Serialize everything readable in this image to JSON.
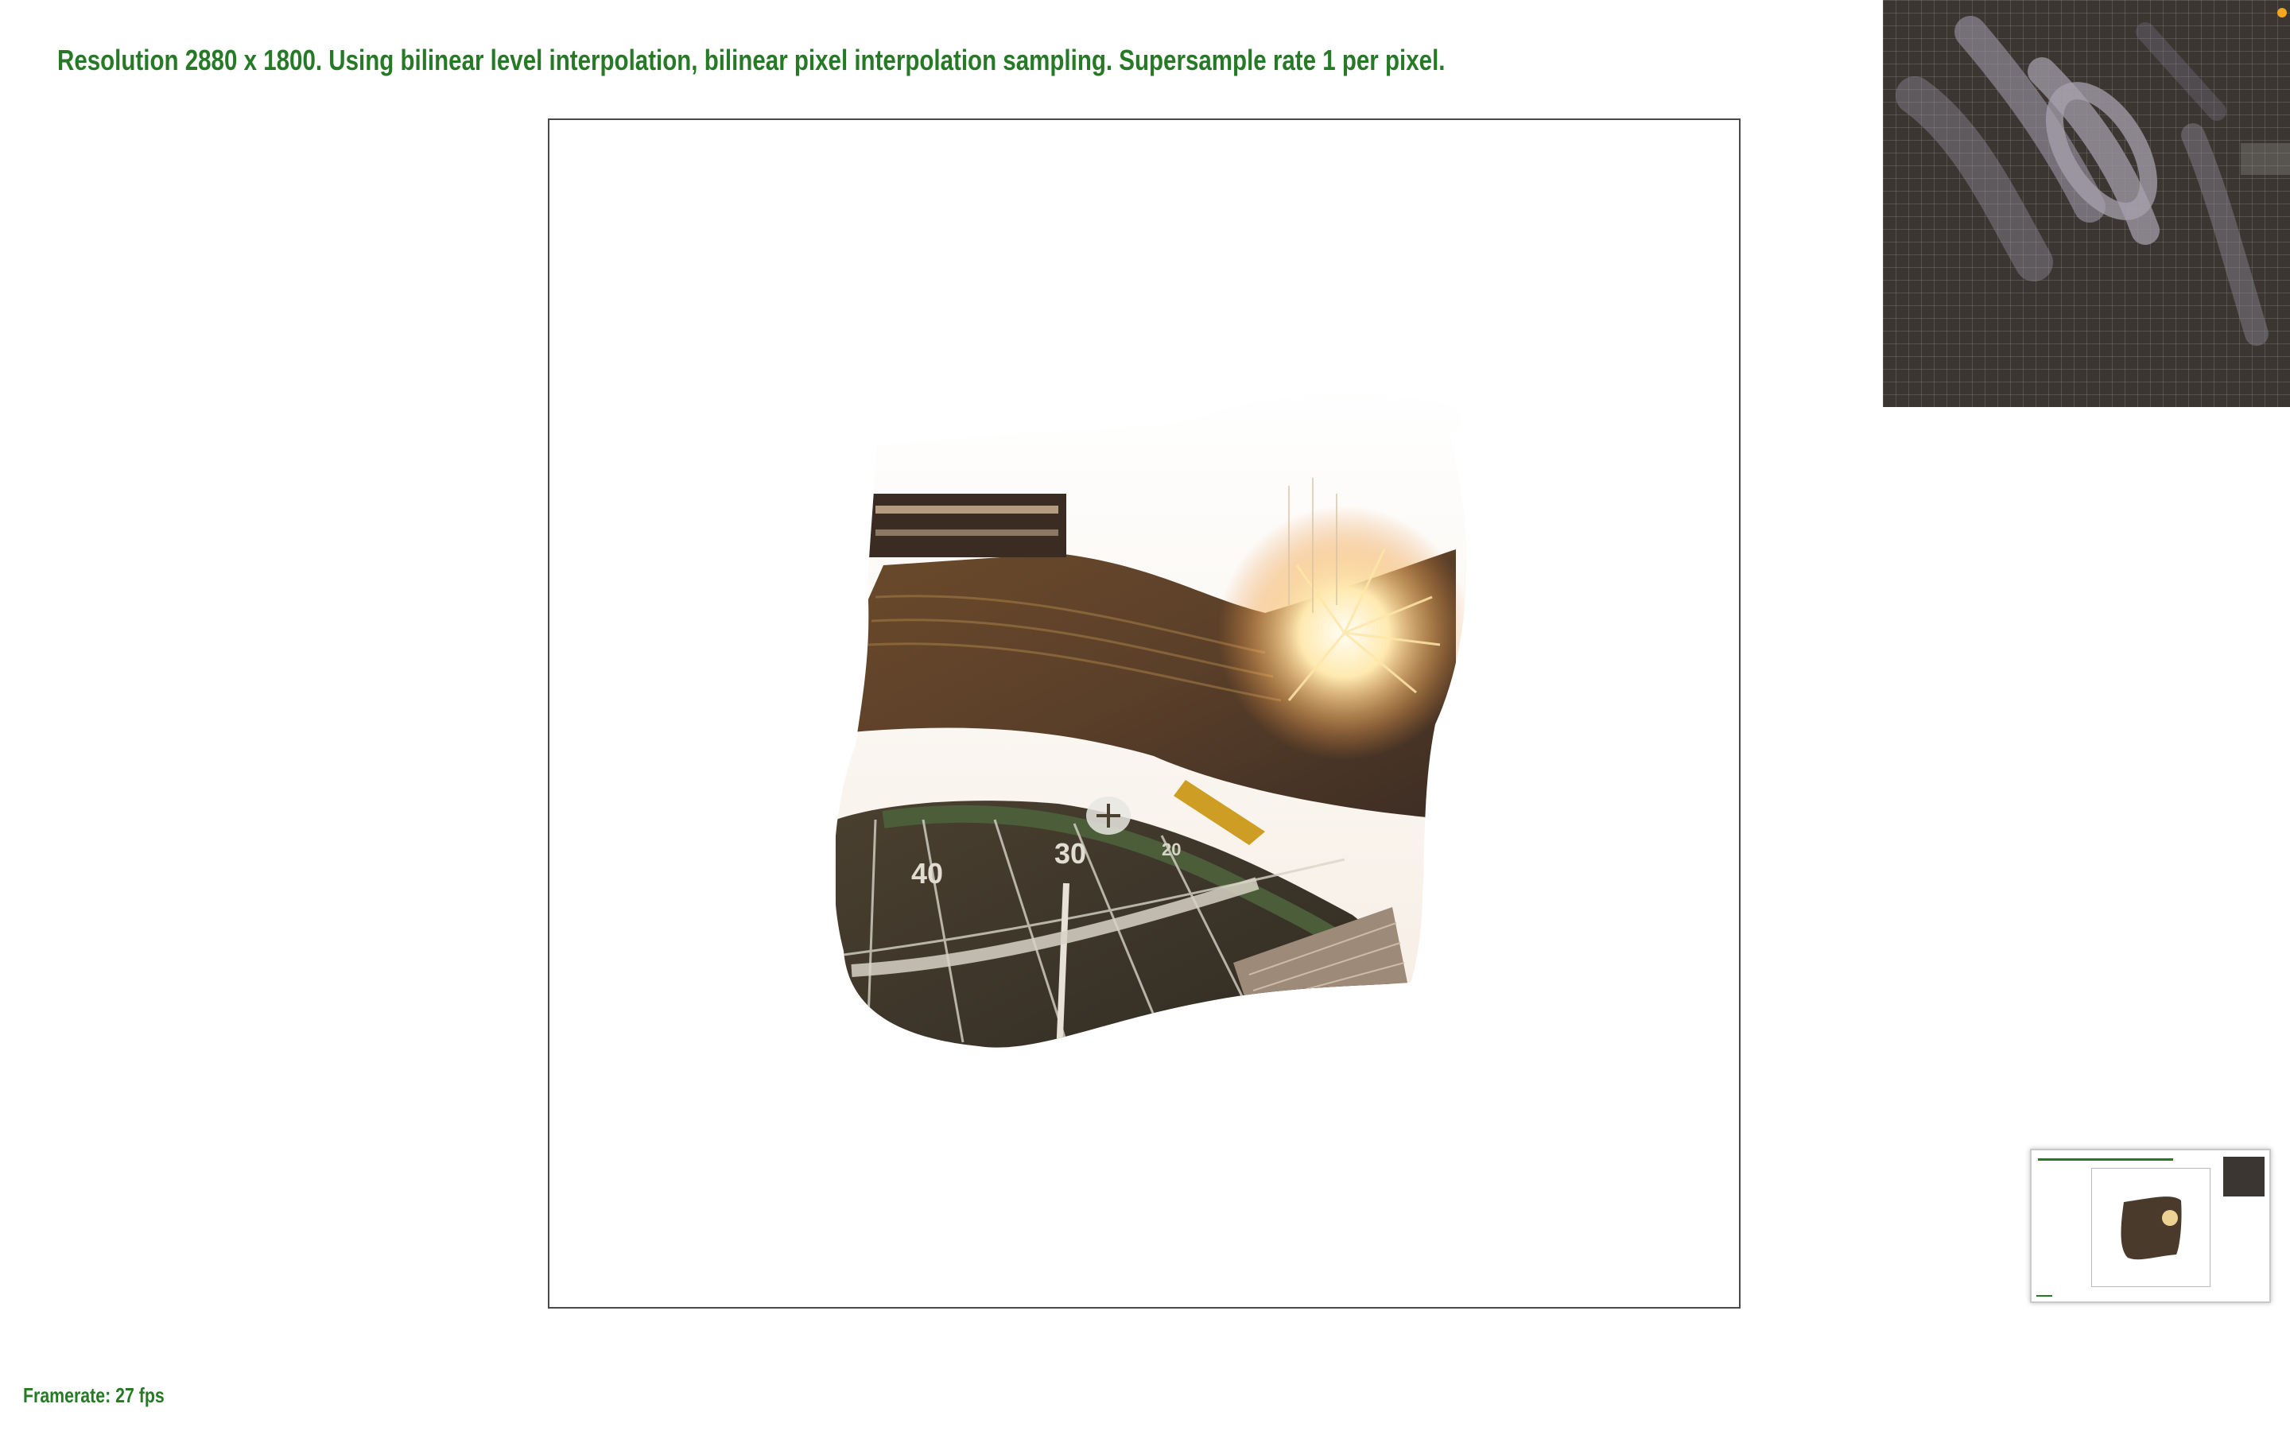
{
  "header": {
    "text": "Resolution 2880 x 1800. Using bilinear level interpolation, bilinear pixel interpolation sampling. Supersample rate 1 per pixel."
  },
  "footer": {
    "framerate_text": "Framerate: 27 fps"
  },
  "canvas": {
    "yard_labels": [
      "40",
      "30",
      "20"
    ]
  },
  "colors": {
    "status_text": "#267a26",
    "canvas_border": "#4a4a4a",
    "zoom_bg": "#3b3631",
    "zoom_marker": "#f5a623"
  }
}
